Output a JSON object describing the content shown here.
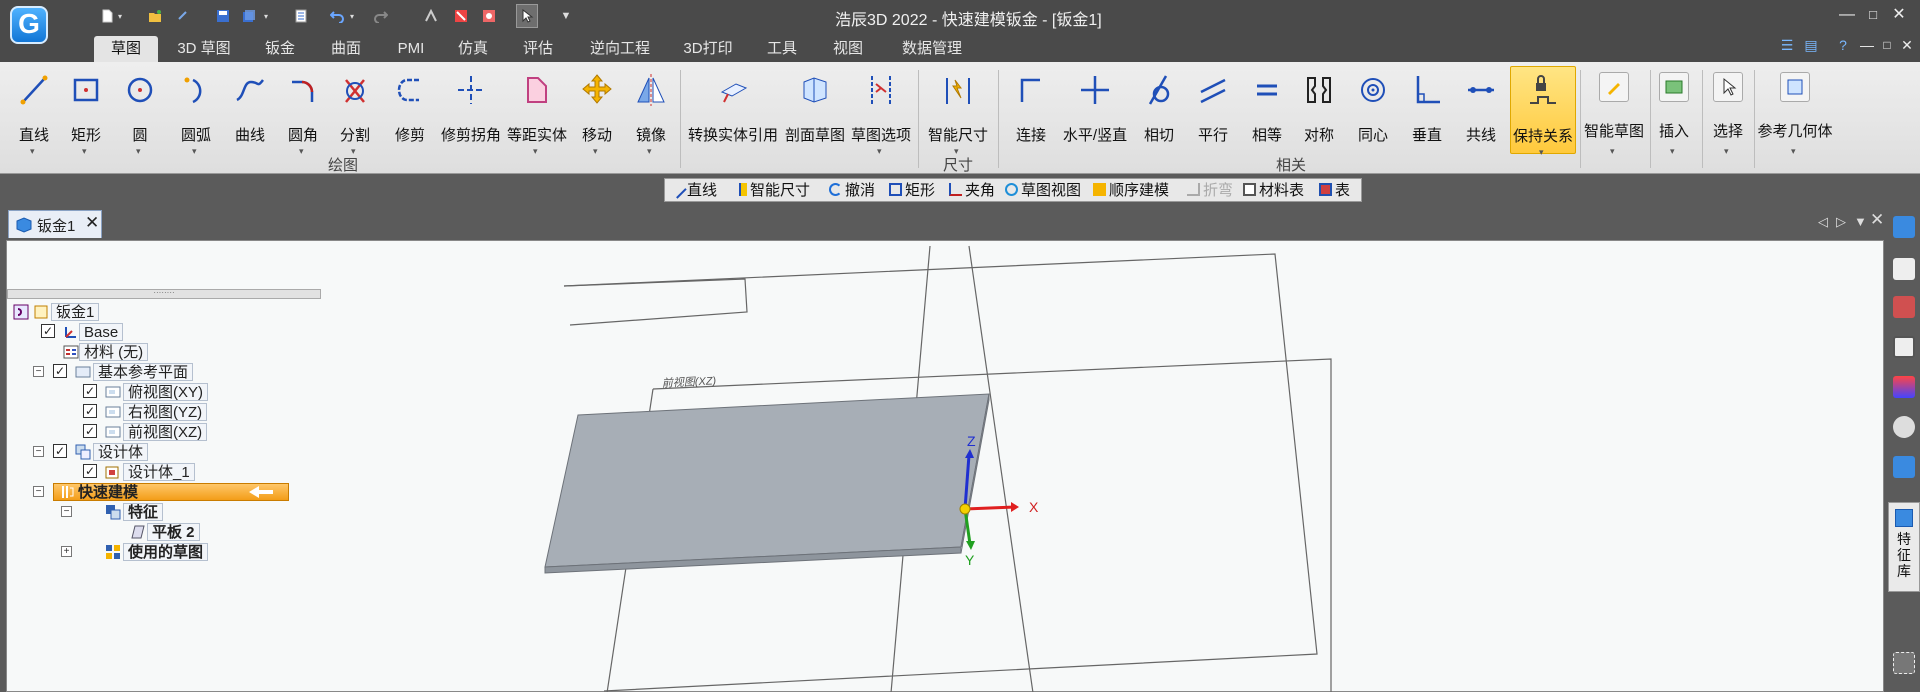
{
  "window": {
    "title": "浩辰3D 2022 - 快速建模钣金 - [钣金1]",
    "logo_letter": "G",
    "controls_top": [
      "—",
      "□",
      "✕"
    ],
    "controls_bottom": [
      "—",
      "□",
      "✕"
    ]
  },
  "menu": {
    "tabs": [
      "草图",
      "3D 草图",
      "钣金",
      "曲面",
      "PMI",
      "仿真",
      "评估",
      "逆向工程",
      "3D打印",
      "工具",
      "视图",
      "数据管理"
    ],
    "active": "草图"
  },
  "ribbon": {
    "draw_tools": [
      "直线",
      "矩形",
      "圆",
      "圆弧",
      "曲线",
      "圆角",
      "分割",
      "修剪",
      "修剪拐角",
      "等距实体",
      "移动",
      "镜像"
    ],
    "draw_group_label": "绘图",
    "mid_tools": [
      "转换实体引用",
      "剖面草图",
      "草图选项"
    ],
    "dim_tool": "智能尺寸",
    "dim_group_label": "尺寸",
    "relation_tools": [
      "连接",
      "水平/竖直",
      "相切",
      "平行",
      "相等",
      "对称",
      "同心",
      "垂直",
      "共线",
      "保持关系"
    ],
    "relation_group_label": "相关",
    "right_tools": [
      "智能草图",
      "插入",
      "选择",
      "参考几何体"
    ],
    "accent": "#ffc93c"
  },
  "cmdbar": {
    "items": [
      "直线",
      "智能尺寸",
      "撤消",
      "矩形",
      "夹角",
      "草图视图",
      "顺序建模",
      "折弯",
      "材料表",
      "表"
    ]
  },
  "doc": {
    "tab_label": "钣金1",
    "close_glyph": "✕"
  },
  "tree": {
    "root": "钣金1",
    "base": "Base",
    "material": "材料 (无)",
    "ref_planes": "基本参考平面",
    "plane_xy": "俯视图(XY)",
    "plane_yz": "右视图(YZ)",
    "plane_xz": "前视图(XZ)",
    "design_body": "设计体",
    "design_body_1": "设计体_1",
    "quick_model": "快速建模",
    "features": "特征",
    "flat_plate": "平板 2",
    "used_sketch": "使用的草图"
  },
  "viewport": {
    "plane_label": "前视图(XZ)",
    "axis_x": "X",
    "axis_y": "Y",
    "axis_z": "Z"
  },
  "sidebar": {
    "feature_library": "特征库"
  }
}
